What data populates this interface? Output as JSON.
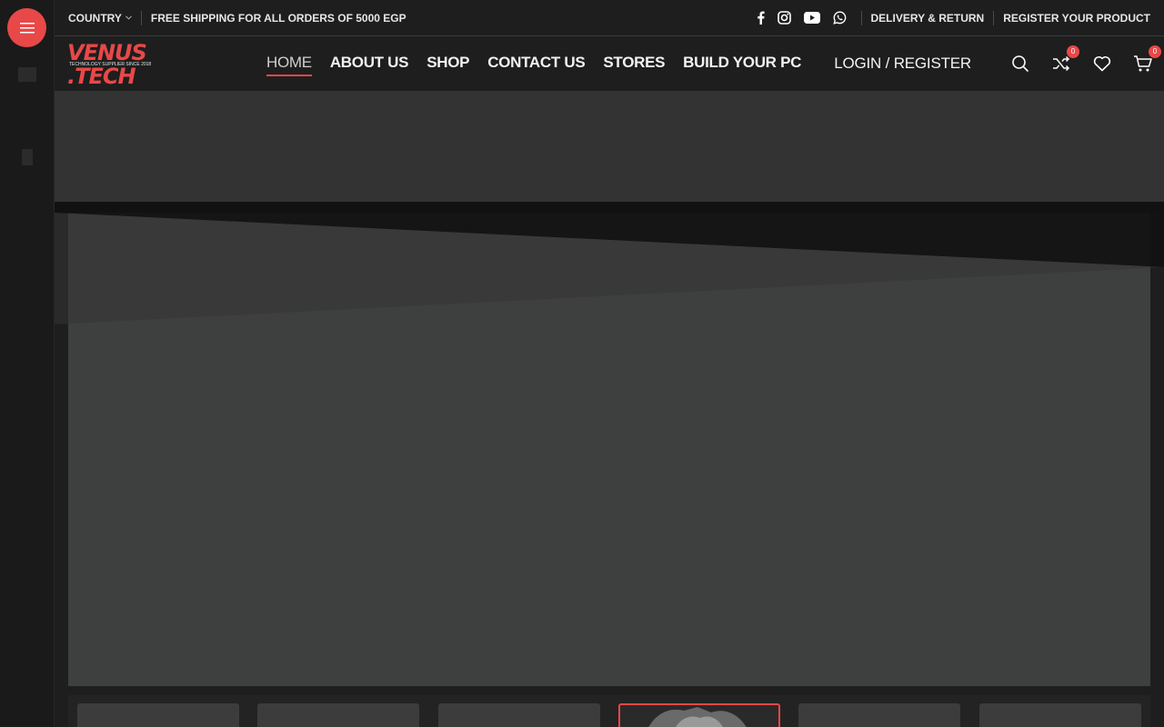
{
  "topbar": {
    "country_label": "COUNTRY",
    "shipping_text": "FREE SHIPPING FOR ALL ORDERS OF 5000 EGP",
    "links": [
      "DELIVERY & RETURN",
      "REGISTER YOUR PRODUCT"
    ],
    "social_icons": [
      "facebook-icon",
      "instagram-icon",
      "youtube-icon",
      "whatsapp-icon"
    ]
  },
  "header": {
    "logo": {
      "line1": "VENUS",
      "tagline": "TECHNOLOGY SUPPLIER SINCE 2018",
      "line2": ".TECH"
    },
    "nav": [
      {
        "label": "HOME",
        "active": true
      },
      {
        "label": "ABOUT US"
      },
      {
        "label": "SHOP"
      },
      {
        "label": "CONTACT US"
      },
      {
        "label": "STORES"
      },
      {
        "label": "BUILD YOUR PC"
      }
    ],
    "login_label": "LOGIN / REGISTER",
    "compare_count": "0",
    "cart_count": "0"
  },
  "colors": {
    "accent": "#e84848",
    "background": "#1e1e1e",
    "slider": "#3e3f3f"
  }
}
